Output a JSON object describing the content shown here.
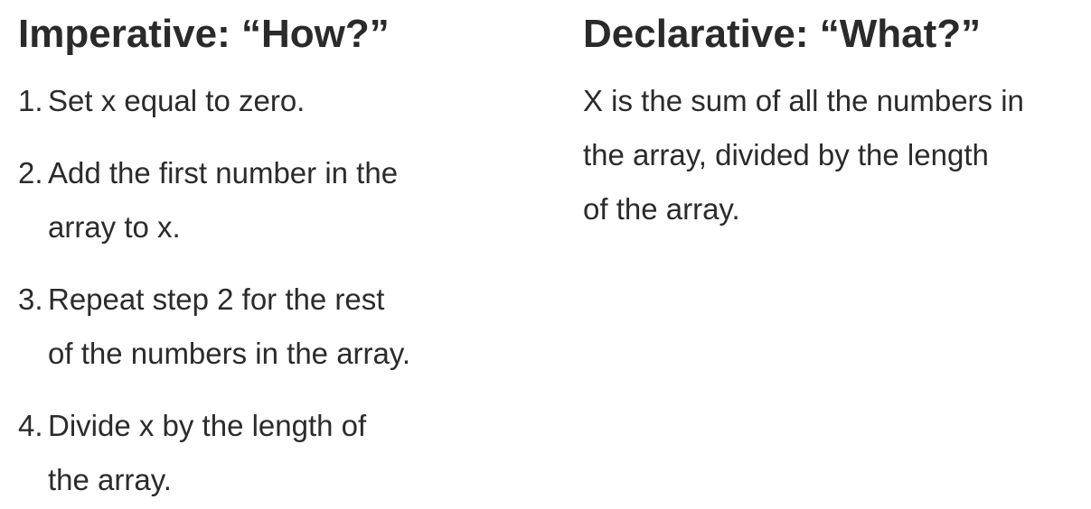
{
  "imperative": {
    "title": "Imperative: “How?”",
    "steps": [
      {
        "num": "1.",
        "line1": "Set x equal to zero.",
        "line2": ""
      },
      {
        "num": "2.",
        "line1": "Add the first number in the",
        "line2": "array to x."
      },
      {
        "num": "3.",
        "line1": "Repeat step 2 for the rest",
        "line2": "of the numbers in the array."
      },
      {
        "num": "4.",
        "line1": "Divide x by the length of",
        "line2": "the array."
      }
    ]
  },
  "declarative": {
    "title": "Declarative: “What?”",
    "lines": [
      "X is the sum of all the numbers in",
      "the array, divided by the length",
      "of the array."
    ]
  }
}
